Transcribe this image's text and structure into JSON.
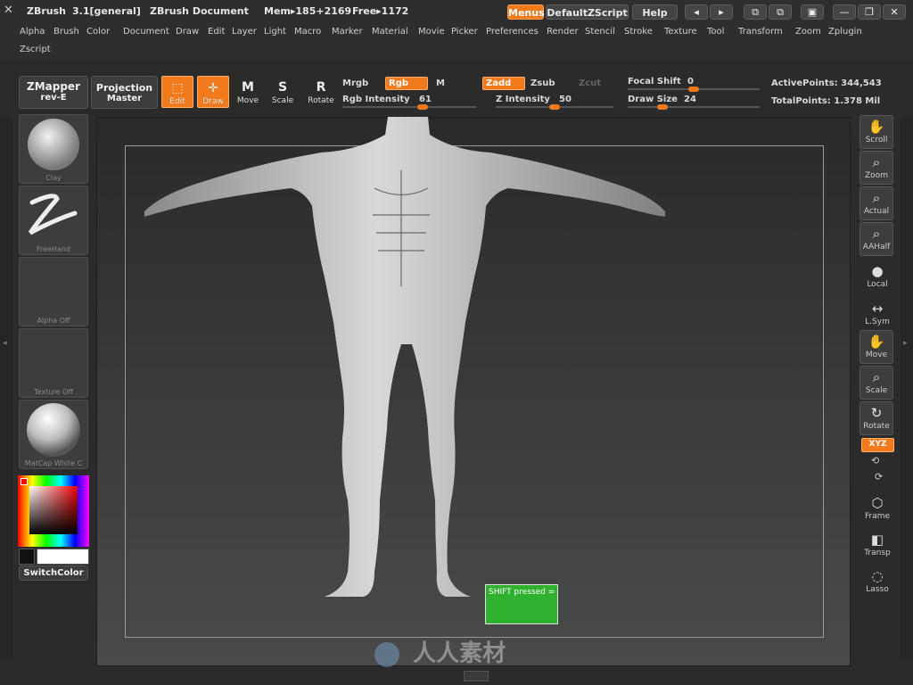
{
  "titlebar": {
    "app": "ZBrush",
    "version": "3.1[general]",
    "document": "ZBrush Document",
    "mem": "Mem▸185+2169",
    "free": "Free▸1172",
    "menus_btn": "Menus",
    "zscript_btn": "DefaultZScript",
    "help_btn": "Help"
  },
  "menubar": {
    "row1": [
      "Alpha",
      "Brush",
      "Color",
      "Document",
      "Draw",
      "Edit",
      "Layer",
      "Light",
      "Macro",
      "Marker",
      "Material",
      "Movie",
      "Picker",
      "Preferences",
      "Render",
      "Stencil",
      "Stroke",
      "Texture",
      "Tool",
      "Transform",
      "Zoom",
      "Zplugin"
    ],
    "row2": [
      "Zscript"
    ]
  },
  "toolbar": {
    "zmapper": "ZMapper",
    "zmapper_sub": "rev-E",
    "projection": "Projection",
    "projection_sub": "Master",
    "edit": "Edit",
    "draw": "Draw",
    "move": "Move",
    "scale": "Scale",
    "rotate": "Rotate",
    "mrgb": "Mrgb",
    "rgb": "Rgb",
    "m": "M",
    "rgb_intensity_label": "Rgb Intensity",
    "rgb_intensity": "61",
    "zadd": "Zadd",
    "zsub": "Zsub",
    "zcut": "Zcut",
    "z_intensity_label": "Z Intensity",
    "z_intensity": "50",
    "focal_shift_label": "Focal Shift",
    "focal_shift": "0",
    "draw_size_label": "Draw Size",
    "draw_size": "24",
    "active_points": "ActivePoints: 344,543",
    "total_points": "TotalPoints: 1.378 Mil"
  },
  "sliders": {
    "rgb_intensity": 0.61,
    "z_intensity": 0.5,
    "focal_shift": 0.5,
    "draw_size": 0.24
  },
  "left_panel": {
    "brush": "Clay",
    "stroke": "FreeHand",
    "alpha": "Alpha  Off",
    "texture": "Texture  Off",
    "material": "MatCap  White  C",
    "switch_color": "SwitchColor"
  },
  "right_panel": {
    "scroll": "Scroll",
    "zoom": "Zoom",
    "actual": "Actual",
    "aahalf": "AAHalf",
    "local": "Local",
    "lsym": "L.Sym",
    "move": "Move",
    "scale": "Scale",
    "rotate": "Rotate",
    "xyz": "XYZ",
    "frame": "Frame",
    "transp": "Transp",
    "lasso": "Lasso"
  },
  "canvas": {
    "shift_note": "SHIFT pressed ="
  },
  "watermark": "人人素材",
  "colors": {
    "accent": "#f07a1c",
    "shift_box": "#2fb02f",
    "panel": "#2e2e2e"
  }
}
